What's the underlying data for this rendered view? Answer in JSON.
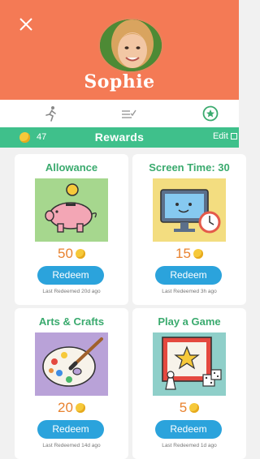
{
  "profile": {
    "name": "Sophie"
  },
  "tabs": [
    {
      "icon": "running-person-icon"
    },
    {
      "icon": "checklist-icon"
    },
    {
      "icon": "star-circle-icon",
      "active": true
    }
  ],
  "rewards_bar": {
    "coin_count": "47",
    "title": "Rewards",
    "edit_label": "Edit"
  },
  "rewards": [
    {
      "title": "Allowance",
      "price": "50",
      "redeem_label": "Redeem",
      "last_redeemed": "Last Redeemed 20d ago",
      "icon": "piggy-bank-icon",
      "bg": "#a6d78e"
    },
    {
      "title": "Screen Time: 30",
      "price": "15",
      "redeem_label": "Redeem",
      "last_redeemed": "Last Redeemed 3h ago",
      "icon": "tv-screen-icon",
      "bg": "#f3dd80"
    },
    {
      "title": "Arts & Crafts",
      "price": "20",
      "redeem_label": "Redeem",
      "last_redeemed": "Last Redeemed 14d ago",
      "icon": "paint-palette-icon",
      "bg": "#b9a2d8"
    },
    {
      "title": "Play a Game",
      "price": "5",
      "redeem_label": "Redeem",
      "last_redeemed": "Last Redeemed 1d ago",
      "icon": "board-game-icon",
      "bg": "#8fcfc9"
    }
  ],
  "colors": {
    "header": "#f47a55",
    "accent_green": "#3fc08b",
    "redeem_blue": "#2ba3dc",
    "price_orange": "#e8822f",
    "coin": "#f6c93a"
  }
}
